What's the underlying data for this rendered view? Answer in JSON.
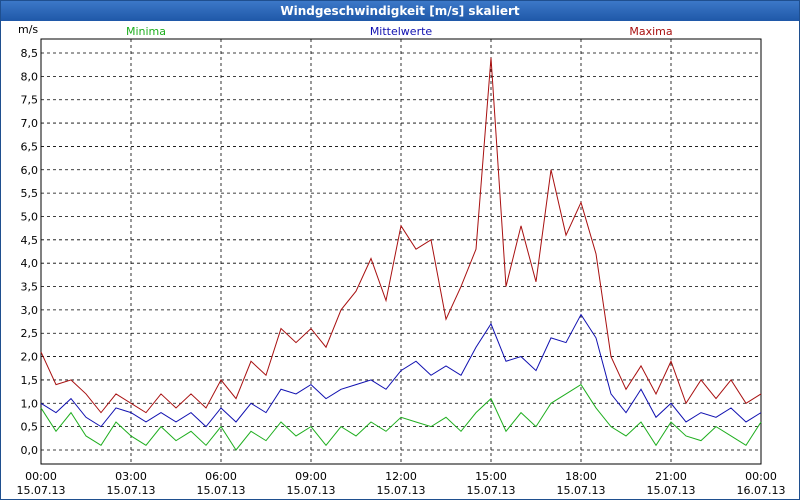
{
  "window": {
    "title": "Windgeschwindigkeit [m/s] skaliert"
  },
  "chart_data": {
    "type": "line",
    "title": "Windgeschwindigkeit [m/s] skaliert",
    "ylabel": "m/s",
    "xlabel": "",
    "ylim": [
      -0.3,
      8.8
    ],
    "yticks": [
      0,
      0.5,
      1,
      1.5,
      2,
      2.5,
      3,
      3.5,
      4,
      4.5,
      5,
      5.5,
      6,
      6.5,
      7,
      7.5,
      8,
      8.5
    ],
    "ytick_labels": [
      "0,0",
      "0,5",
      "1,0",
      "1,5",
      "2,0",
      "2,5",
      "3,0",
      "3,5",
      "4,0",
      "4,5",
      "5,0",
      "5,5",
      "6,0",
      "6,5",
      "7,0",
      "7,5",
      "8,0",
      "8,5"
    ],
    "xlim": [
      0,
      24
    ],
    "xticks": [
      0,
      3,
      6,
      9,
      12,
      15,
      18,
      21,
      24
    ],
    "xtick_labels": [
      [
        "00:00",
        "15.07.13"
      ],
      [
        "03:00",
        "15.07.13"
      ],
      [
        "06:00",
        "15.07.13"
      ],
      [
        "09:00",
        "15.07.13"
      ],
      [
        "12:00",
        "15.07.13"
      ],
      [
        "15:00",
        "15.07.13"
      ],
      [
        "18:00",
        "15.07.13"
      ],
      [
        "21:00",
        "15.07.13"
      ],
      [
        "00:00",
        "16.07.13"
      ]
    ],
    "grid": true,
    "legend_position": "top",
    "x_hours": [
      0,
      0.5,
      1,
      1.5,
      2,
      2.5,
      3,
      3.5,
      4,
      4.5,
      5,
      5.5,
      6,
      6.5,
      7,
      7.5,
      8,
      8.5,
      9,
      9.5,
      10,
      10.5,
      11,
      11.5,
      12,
      12.5,
      13,
      13.5,
      14,
      14.5,
      15,
      15.5,
      16,
      16.5,
      17,
      17.5,
      18,
      18.5,
      19,
      19.5,
      20,
      20.5,
      21,
      21.5,
      22,
      22.5,
      23,
      23.5,
      24
    ],
    "series": [
      {
        "name": "Minima",
        "color": "#1fae1f",
        "values": [
          0.9,
          0.4,
          0.8,
          0.3,
          0.1,
          0.6,
          0.3,
          0.1,
          0.5,
          0.2,
          0.4,
          0.1,
          0.5,
          0.0,
          0.4,
          0.2,
          0.6,
          0.3,
          0.5,
          0.1,
          0.5,
          0.3,
          0.6,
          0.4,
          0.7,
          0.6,
          0.5,
          0.7,
          0.4,
          0.8,
          1.1,
          0.4,
          0.8,
          0.5,
          1.0,
          1.2,
          1.4,
          0.9,
          0.5,
          0.3,
          0.6,
          0.1,
          0.6,
          0.3,
          0.2,
          0.5,
          0.3,
          0.1,
          0.6
        ]
      },
      {
        "name": "Mittelwerte",
        "color": "#1010b0",
        "values": [
          1.0,
          0.8,
          1.1,
          0.7,
          0.5,
          0.9,
          0.8,
          0.6,
          0.8,
          0.6,
          0.8,
          0.5,
          0.9,
          0.6,
          1.0,
          0.8,
          1.3,
          1.2,
          1.4,
          1.1,
          1.3,
          1.4,
          1.5,
          1.3,
          1.7,
          1.9,
          1.6,
          1.8,
          1.6,
          2.2,
          2.7,
          1.9,
          2.0,
          1.7,
          2.4,
          2.3,
          2.9,
          2.4,
          1.2,
          0.8,
          1.3,
          0.7,
          1.0,
          0.6,
          0.8,
          0.7,
          0.9,
          0.6,
          0.8
        ]
      },
      {
        "name": "Maxima",
        "color": "#a81010",
        "values": [
          2.1,
          1.4,
          1.5,
          1.2,
          0.8,
          1.2,
          1.0,
          0.8,
          1.2,
          0.9,
          1.2,
          0.9,
          1.5,
          1.1,
          1.9,
          1.6,
          2.6,
          2.3,
          2.6,
          2.2,
          3.0,
          3.4,
          4.1,
          3.2,
          4.8,
          4.3,
          4.5,
          2.8,
          3.5,
          4.3,
          8.4,
          3.5,
          4.8,
          3.6,
          6.0,
          4.6,
          5.3,
          4.2,
          2.0,
          1.3,
          1.8,
          1.2,
          1.9,
          1.0,
          1.5,
          1.1,
          1.5,
          1.0,
          1.2
        ]
      }
    ]
  }
}
